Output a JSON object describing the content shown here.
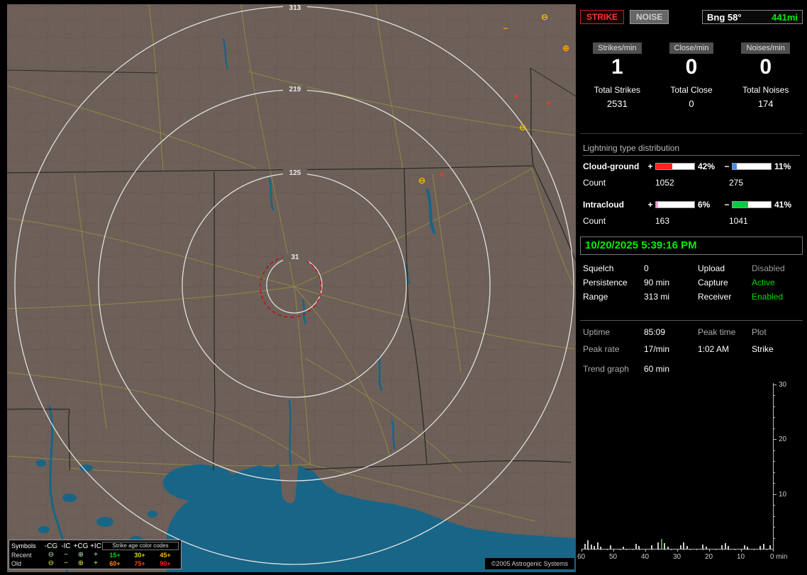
{
  "colors": {
    "land": "#6d6058",
    "water": "#186587",
    "ring": "#e0e0e0",
    "alarm_ring": "#d40000",
    "accent_green": "#00dd00"
  },
  "map": {
    "ring_labels": [
      "313",
      "219",
      "125",
      "31"
    ],
    "marker_glyphs": {
      "cg": "⊖",
      "ic": "−",
      "pcg": "⊕",
      "pic": "+"
    },
    "legend": {
      "col_symbols": "Symbols",
      "col_ncg": "-CG",
      "col_nic": "-IC",
      "col_pcg": "+CG",
      "col_pic": "+IC",
      "age_title": "Strike age color codes",
      "recent_label": "Recent",
      "old_label": "Old",
      "ages_recent": [
        {
          "t": "15+",
          "c": "#00dd00"
        },
        {
          "t": "30+",
          "c": "#dddd00"
        },
        {
          "t": "45+",
          "c": "#ffbb00"
        }
      ],
      "ages_old": [
        {
          "t": "60+",
          "c": "#ff8800"
        },
        {
          "t": "75+",
          "c": "#ff4400"
        },
        {
          "t": "90+",
          "c": "#ff2222"
        }
      ]
    },
    "copyright": "©2005 Astrogenic Systems"
  },
  "panel": {
    "strike_button": "STRIKE",
    "noise_button": "NOISE",
    "bearing": "Bng 58°",
    "bearing_range": "441mi",
    "rates": [
      {
        "label": "Strikes/min",
        "value": "1",
        "total_label": "Total Strikes",
        "total": "2531"
      },
      {
        "label": "Close/min",
        "value": "0",
        "total_label": "Total Close",
        "total": "0"
      },
      {
        "label": "Noises/min",
        "value": "0",
        "total_label": "Total Noises",
        "total": "174"
      }
    ],
    "distribution": {
      "title": "Lightning type distribution",
      "count_label": "Count",
      "plus_sign": "+",
      "minus_sign": "−",
      "rows": [
        {
          "name": "Cloud-ground",
          "plus": {
            "pct": "42%",
            "value": 42,
            "color": "#ff2020",
            "count": "1052"
          },
          "minus": {
            "pct": "11%",
            "value": 11,
            "color": "#4488ff",
            "count": "275"
          }
        },
        {
          "name": "Intracloud",
          "plus": {
            "pct": "6%",
            "value": 6,
            "color": "#ff99cc",
            "count": "163"
          },
          "minus": {
            "pct": "41%",
            "value": 41,
            "color": "#00cc44",
            "count": "1041"
          }
        }
      ]
    },
    "datetime": "10/20/2025 5:39:16 PM",
    "settings": [
      {
        "l1": "Squelch",
        "v1": "0",
        "l2": "Upload",
        "v2": "Disabled"
      },
      {
        "l1": "Persistence",
        "v1": "90 min",
        "l2": "Capture",
        "v2": "Active"
      },
      {
        "l1": "Range",
        "v1": "313 mi",
        "l2": "Receiver",
        "v2": "Enabled"
      }
    ],
    "status": {
      "r1": [
        "Uptime",
        "85:09",
        "Peak time",
        "Plot"
      ],
      "r2": [
        "Peak rate",
        "17/min",
        "1:02 AM",
        "Strike"
      ]
    },
    "trend_label": "Trend graph",
    "trend_window": "60 min"
  },
  "chart_data": {
    "type": "bar",
    "title": "Strike rate trend, last 60 minutes",
    "xlabel": "min",
    "x_ticks": [
      60,
      50,
      40,
      30,
      20,
      10,
      0
    ],
    "y_ticks": [
      30,
      20,
      10
    ],
    "ylim": [
      0,
      30
    ],
    "x_range_minutes_ago": [
      60,
      0
    ],
    "legend_position": "none",
    "grid": false,
    "bar_color": "#cccccc",
    "bars": [
      {
        "m": 59,
        "v": 0.9
      },
      {
        "m": 58,
        "v": 1.6
      },
      {
        "m": 57,
        "v": 0.8
      },
      {
        "m": 56,
        "v": 0.5
      },
      {
        "m": 55,
        "v": 1.1
      },
      {
        "m": 54,
        "v": 0.4
      },
      {
        "m": 51,
        "v": 0.6
      },
      {
        "m": 47,
        "v": 0.4
      },
      {
        "m": 43,
        "v": 0.9
      },
      {
        "m": 42,
        "v": 0.5
      },
      {
        "m": 38,
        "v": 0.7
      },
      {
        "m": 36,
        "v": 1.2
      },
      {
        "m": 35,
        "v": 1.8,
        "c": "#00cc00"
      },
      {
        "m": 34,
        "v": 1.0
      },
      {
        "m": 33,
        "v": 0.4
      },
      {
        "m": 29,
        "v": 0.6
      },
      {
        "m": 28,
        "v": 1.1
      },
      {
        "m": 27,
        "v": 0.5
      },
      {
        "m": 22,
        "v": 0.8
      },
      {
        "m": 21,
        "v": 0.4
      },
      {
        "m": 16,
        "v": 0.6
      },
      {
        "m": 15,
        "v": 1.0
      },
      {
        "m": 14,
        "v": 0.5
      },
      {
        "m": 9,
        "v": 0.7
      },
      {
        "m": 8,
        "v": 0.4
      },
      {
        "m": 4,
        "v": 0.5
      },
      {
        "m": 3,
        "v": 0.9
      },
      {
        "m": 1,
        "v": 0.6
      }
    ]
  }
}
